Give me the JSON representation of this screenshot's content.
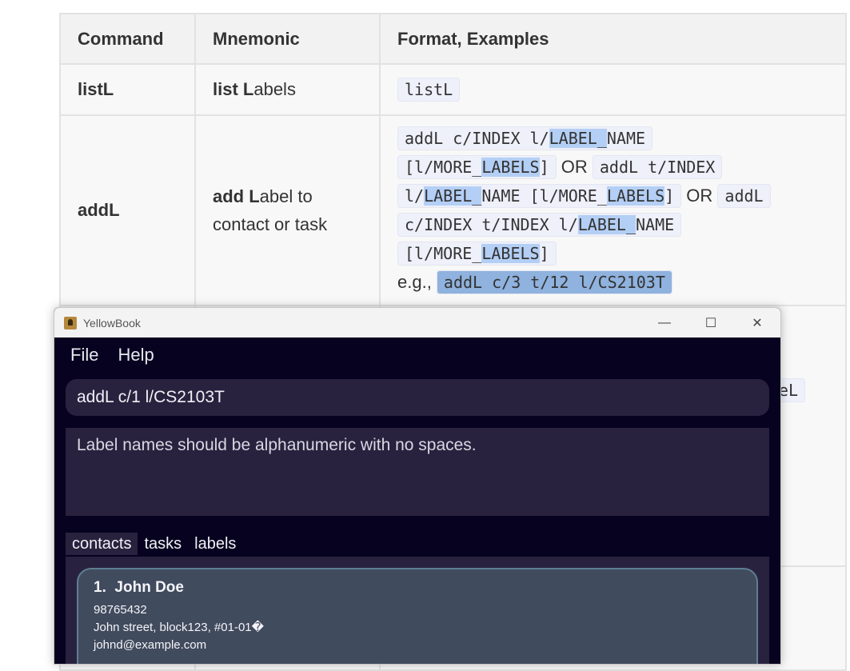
{
  "doc": {
    "headers": [
      "Command",
      "Mnemonic",
      "Format, Examples"
    ],
    "row_listL": {
      "command": "listL",
      "mnemonic_bold": "list L",
      "mnemonic_rest": "abels",
      "format": "listL"
    },
    "row_addL": {
      "command": "addL",
      "mnemonic_bold": "add L",
      "mnemonic_rest": "abel to contact or task",
      "fmt": {
        "p1": "addL c/INDEX l/",
        "p1_hl": "LABEL_",
        "p1_end": "NAME",
        "p2": "[l/MORE_",
        "p2_hl": "LABELS",
        "p2_end": "]",
        "or1": " OR ",
        "p3": "addL t/INDEX",
        "p4": "l/",
        "p4_hl": "LABEL_",
        "p4_end": "NAME [l/MORE_",
        "p4_hl2": "LABELS",
        "p4_end2": "]",
        "or2": " OR ",
        "p5": "addL",
        "p6": "c/INDEX t/INDEX l/",
        "p6_hl": "LABEL_",
        "p6_end": "NAME",
        "p7": "[l/MORE_",
        "p7_hl": "LABELS",
        "p7_end": "]",
        "eg": "e.g., ",
        "example": "addL c/3 t/12 l/CS2103T"
      }
    },
    "partial_code": "eL"
  },
  "window": {
    "title": "YellowBook",
    "minimize": "—",
    "maximize": "☐",
    "close": "✕"
  },
  "menu": {
    "file": "File",
    "help": "Help"
  },
  "command_input": {
    "value": "addL c/1 l/CS2103T"
  },
  "result": {
    "text": "Label names should be alphanumeric with no spaces."
  },
  "tabs": {
    "contacts": "contacts",
    "tasks": "tasks",
    "labels": "labels",
    "active": "contacts"
  },
  "contacts": [
    {
      "index": "1.",
      "name": "John Doe",
      "phone": "98765432",
      "address": "John street, block123, #01-01�",
      "email": "johnd@example.com"
    }
  ]
}
